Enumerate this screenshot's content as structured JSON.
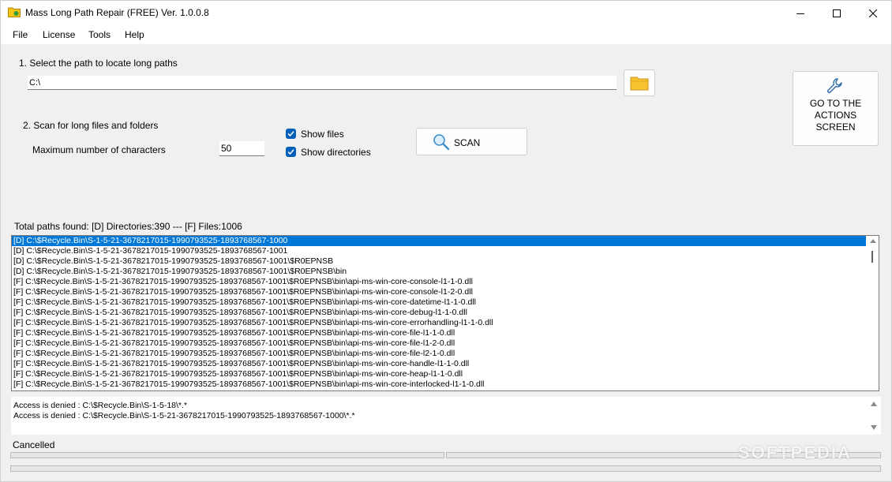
{
  "window": {
    "title": "Mass Long Path Repair (FREE) Ver. 1.0.0.8",
    "app_icon": "folder-icon"
  },
  "menu": {
    "file": "File",
    "license": "License",
    "tools": "Tools",
    "help": "Help"
  },
  "step1": {
    "label": "1. Select the path to locate long paths",
    "path_value": "C:\\",
    "browse_icon": "folder-icon"
  },
  "actions_button": {
    "label": "GO TO THE\nACTIONS\nSCREEN",
    "icon": "wrench-icon"
  },
  "step2": {
    "label": "2. Scan for long files and folders",
    "max_label": "Maximum number of characters",
    "max_value": "50",
    "show_files": {
      "label": "Show files",
      "checked": true
    },
    "show_dirs": {
      "label": "Show directories",
      "checked": true
    },
    "scan_label": "SCAN",
    "scan_icon": "magnifier-icon"
  },
  "summary": "Total paths found: [D] Directories:390 --- [F] Files:1006",
  "paths": [
    "[D] C:\\$Recycle.Bin\\S-1-5-21-3678217015-1990793525-1893768567-1000",
    "[D] C:\\$Recycle.Bin\\S-1-5-21-3678217015-1990793525-1893768567-1001",
    "[D] C:\\$Recycle.Bin\\S-1-5-21-3678217015-1990793525-1893768567-1001\\$R0EPNSB",
    "[D] C:\\$Recycle.Bin\\S-1-5-21-3678217015-1990793525-1893768567-1001\\$R0EPNSB\\bin",
    "[F] C:\\$Recycle.Bin\\S-1-5-21-3678217015-1990793525-1893768567-1001\\$R0EPNSB\\bin\\api-ms-win-core-console-l1-1-0.dll",
    "[F] C:\\$Recycle.Bin\\S-1-5-21-3678217015-1990793525-1893768567-1001\\$R0EPNSB\\bin\\api-ms-win-core-console-l1-2-0.dll",
    "[F] C:\\$Recycle.Bin\\S-1-5-21-3678217015-1990793525-1893768567-1001\\$R0EPNSB\\bin\\api-ms-win-core-datetime-l1-1-0.dll",
    "[F] C:\\$Recycle.Bin\\S-1-5-21-3678217015-1990793525-1893768567-1001\\$R0EPNSB\\bin\\api-ms-win-core-debug-l1-1-0.dll",
    "[F] C:\\$Recycle.Bin\\S-1-5-21-3678217015-1990793525-1893768567-1001\\$R0EPNSB\\bin\\api-ms-win-core-errorhandling-l1-1-0.dll",
    "[F] C:\\$Recycle.Bin\\S-1-5-21-3678217015-1990793525-1893768567-1001\\$R0EPNSB\\bin\\api-ms-win-core-file-l1-1-0.dll",
    "[F] C:\\$Recycle.Bin\\S-1-5-21-3678217015-1990793525-1893768567-1001\\$R0EPNSB\\bin\\api-ms-win-core-file-l1-2-0.dll",
    "[F] C:\\$Recycle.Bin\\S-1-5-21-3678217015-1990793525-1893768567-1001\\$R0EPNSB\\bin\\api-ms-win-core-file-l2-1-0.dll",
    "[F] C:\\$Recycle.Bin\\S-1-5-21-3678217015-1990793525-1893768567-1001\\$R0EPNSB\\bin\\api-ms-win-core-handle-l1-1-0.dll",
    "[F] C:\\$Recycle.Bin\\S-1-5-21-3678217015-1990793525-1893768567-1001\\$R0EPNSB\\bin\\api-ms-win-core-heap-l1-1-0.dll",
    "[F] C:\\$Recycle.Bin\\S-1-5-21-3678217015-1990793525-1893768567-1001\\$R0EPNSB\\bin\\api-ms-win-core-interlocked-l1-1-0.dll"
  ],
  "log": [
    "Access is denied : C:\\$Recycle.Bin\\S-1-5-18\\*.*",
    "Access is denied : C:\\$Recycle.Bin\\S-1-5-21-3678217015-1990793525-1893768567-1000\\*.*"
  ],
  "status": "Cancelled",
  "watermark": "SOFTPEDIA"
}
